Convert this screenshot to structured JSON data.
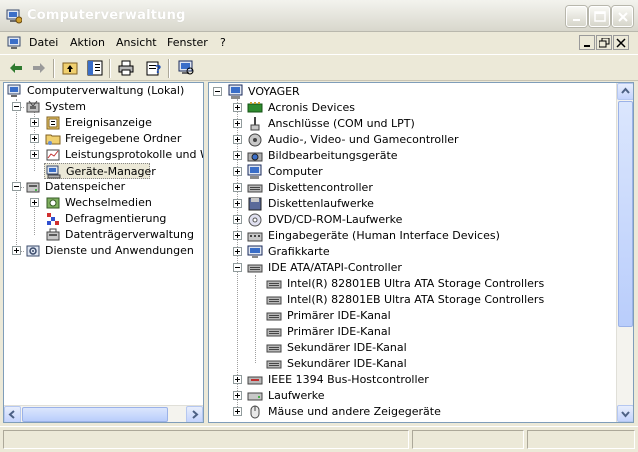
{
  "window": {
    "title": "Computerverwaltung"
  },
  "menu": {
    "items": [
      "Datei",
      "Aktion",
      "Ansicht",
      "Fenster",
      "?"
    ]
  },
  "left_tree": {
    "root": "Computerverwaltung (Lokal)",
    "system": "System",
    "system_items": [
      "Ereignisanzeige",
      "Freigegebene Ordner",
      "Leistungsprotokolle und Warn",
      "Geräte-Manager"
    ],
    "storage": "Datenspeicher",
    "storage_items": [
      "Wechselmedien",
      "Defragmentierung",
      "Datenträgerverwaltung"
    ],
    "services": "Dienste und Anwendungen",
    "selected": "Geräte-Manager"
  },
  "right_tree": {
    "root": "VOYAGER",
    "items": [
      {
        "label": "Acronis Devices",
        "icon": "device-icon"
      },
      {
        "label": "Anschlüsse (COM und LPT)",
        "icon": "port-icon"
      },
      {
        "label": "Audio-, Video- und Gamecontroller",
        "icon": "audio-icon"
      },
      {
        "label": "Bildbearbeitungsgeräte",
        "icon": "camera-icon"
      },
      {
        "label": "Computer",
        "icon": "computer-icon"
      },
      {
        "label": "Diskettencontroller",
        "icon": "controller-icon"
      },
      {
        "label": "Diskettenlaufwerke",
        "icon": "floppy-icon"
      },
      {
        "label": "DVD/CD-ROM-Laufwerke",
        "icon": "cdrom-icon"
      },
      {
        "label": "Eingabegeräte (Human Interface Devices)",
        "icon": "hid-icon"
      },
      {
        "label": "Grafikkarte",
        "icon": "display-icon"
      },
      {
        "label": "IDE ATA/ATAPI-Controller",
        "icon": "controller-icon"
      }
    ],
    "ide_children": [
      "Intel(R) 82801EB Ultra ATA Storage Controllers",
      "Intel(R) 82801EB Ultra ATA Storage Controllers",
      "Primärer IDE-Kanal",
      "Primärer IDE-Kanal",
      "Sekundärer IDE-Kanal",
      "Sekundärer IDE-Kanal"
    ],
    "after_items": [
      {
        "label": "IEEE 1394 Bus-Hostcontroller",
        "icon": "firewire-icon"
      },
      {
        "label": "Laufwerke",
        "icon": "drive-icon"
      },
      {
        "label": "Mäuse und andere Zeigegeräte",
        "icon": "mouse-icon"
      }
    ]
  },
  "colors": {
    "title_text": "#ffffff",
    "pane_border": "#7f9db9",
    "chrome": "#ece9d8"
  }
}
